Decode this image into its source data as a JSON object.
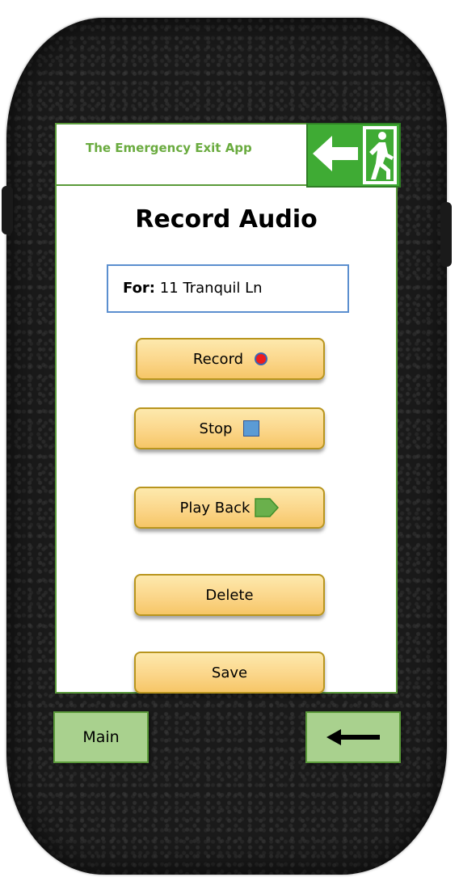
{
  "header": {
    "app_title": "The Emergency Exit App",
    "logo_icon": "emergency-exit-icon",
    "logo_color": "#3fab34"
  },
  "page": {
    "title": "Record Audio"
  },
  "address": {
    "label": "For:",
    "value": "11 Tranquil Ln"
  },
  "buttons": [
    {
      "label": "Record",
      "icon": "record-icon"
    },
    {
      "label": "Stop",
      "icon": "stop-icon"
    },
    {
      "label": "Play Back",
      "icon": "play-icon"
    },
    {
      "label": "Delete",
      "icon": ""
    },
    {
      "label": "Save",
      "icon": ""
    }
  ],
  "nav": {
    "main_label": "Main",
    "back_icon": "back-arrow-icon"
  },
  "colors": {
    "accent_green": "#a9d18e",
    "button_fill": "#fbd68a",
    "button_border": "#b8951e",
    "title_green": "#6aab3f",
    "for_box_border": "#5b8fcf"
  }
}
